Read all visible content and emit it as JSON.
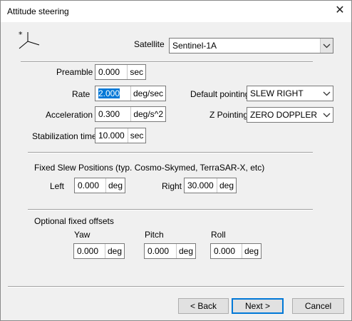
{
  "window": {
    "title": "Attitude steering"
  },
  "satellite": {
    "label": "Satellite",
    "value": "Sentinel-1A"
  },
  "preamble": {
    "label": "Preamble",
    "value": "0.000",
    "unit": "sec"
  },
  "rate": {
    "label": "Rate",
    "value": "2.000",
    "unit": "deg/sec"
  },
  "acceleration": {
    "label": "Acceleration",
    "value": "0.300",
    "unit": "deg/s^2"
  },
  "stabilization": {
    "label": "Stabilization time",
    "value": "10.000",
    "unit": "sec"
  },
  "default_pointing": {
    "label": "Default pointing",
    "value": "SLEW RIGHT"
  },
  "z_pointing": {
    "label": "Z Pointing",
    "value": "ZERO DOPPLER"
  },
  "fixed_slew": {
    "heading": "Fixed Slew Positions (typ. Cosmo-Skymed, TerraSAR-X, etc)",
    "left": {
      "label": "Left",
      "value": "0.000",
      "unit": "deg"
    },
    "right": {
      "label": "Right",
      "value": "30.000",
      "unit": "deg"
    }
  },
  "offsets": {
    "heading": "Optional fixed offsets",
    "yaw": {
      "label": "Yaw",
      "value": "0.000",
      "unit": "deg"
    },
    "pitch": {
      "label": "Pitch",
      "value": "0.000",
      "unit": "deg"
    },
    "roll": {
      "label": "Roll",
      "value": "0.000",
      "unit": "deg"
    }
  },
  "buttons": {
    "back": "< Back",
    "next": "Next >",
    "cancel": "Cancel"
  },
  "icons": {
    "close": "close-icon",
    "axes": "axes-icon",
    "dropdown": "chevron-down-icon"
  },
  "colors": {
    "accent": "#0078d7"
  }
}
